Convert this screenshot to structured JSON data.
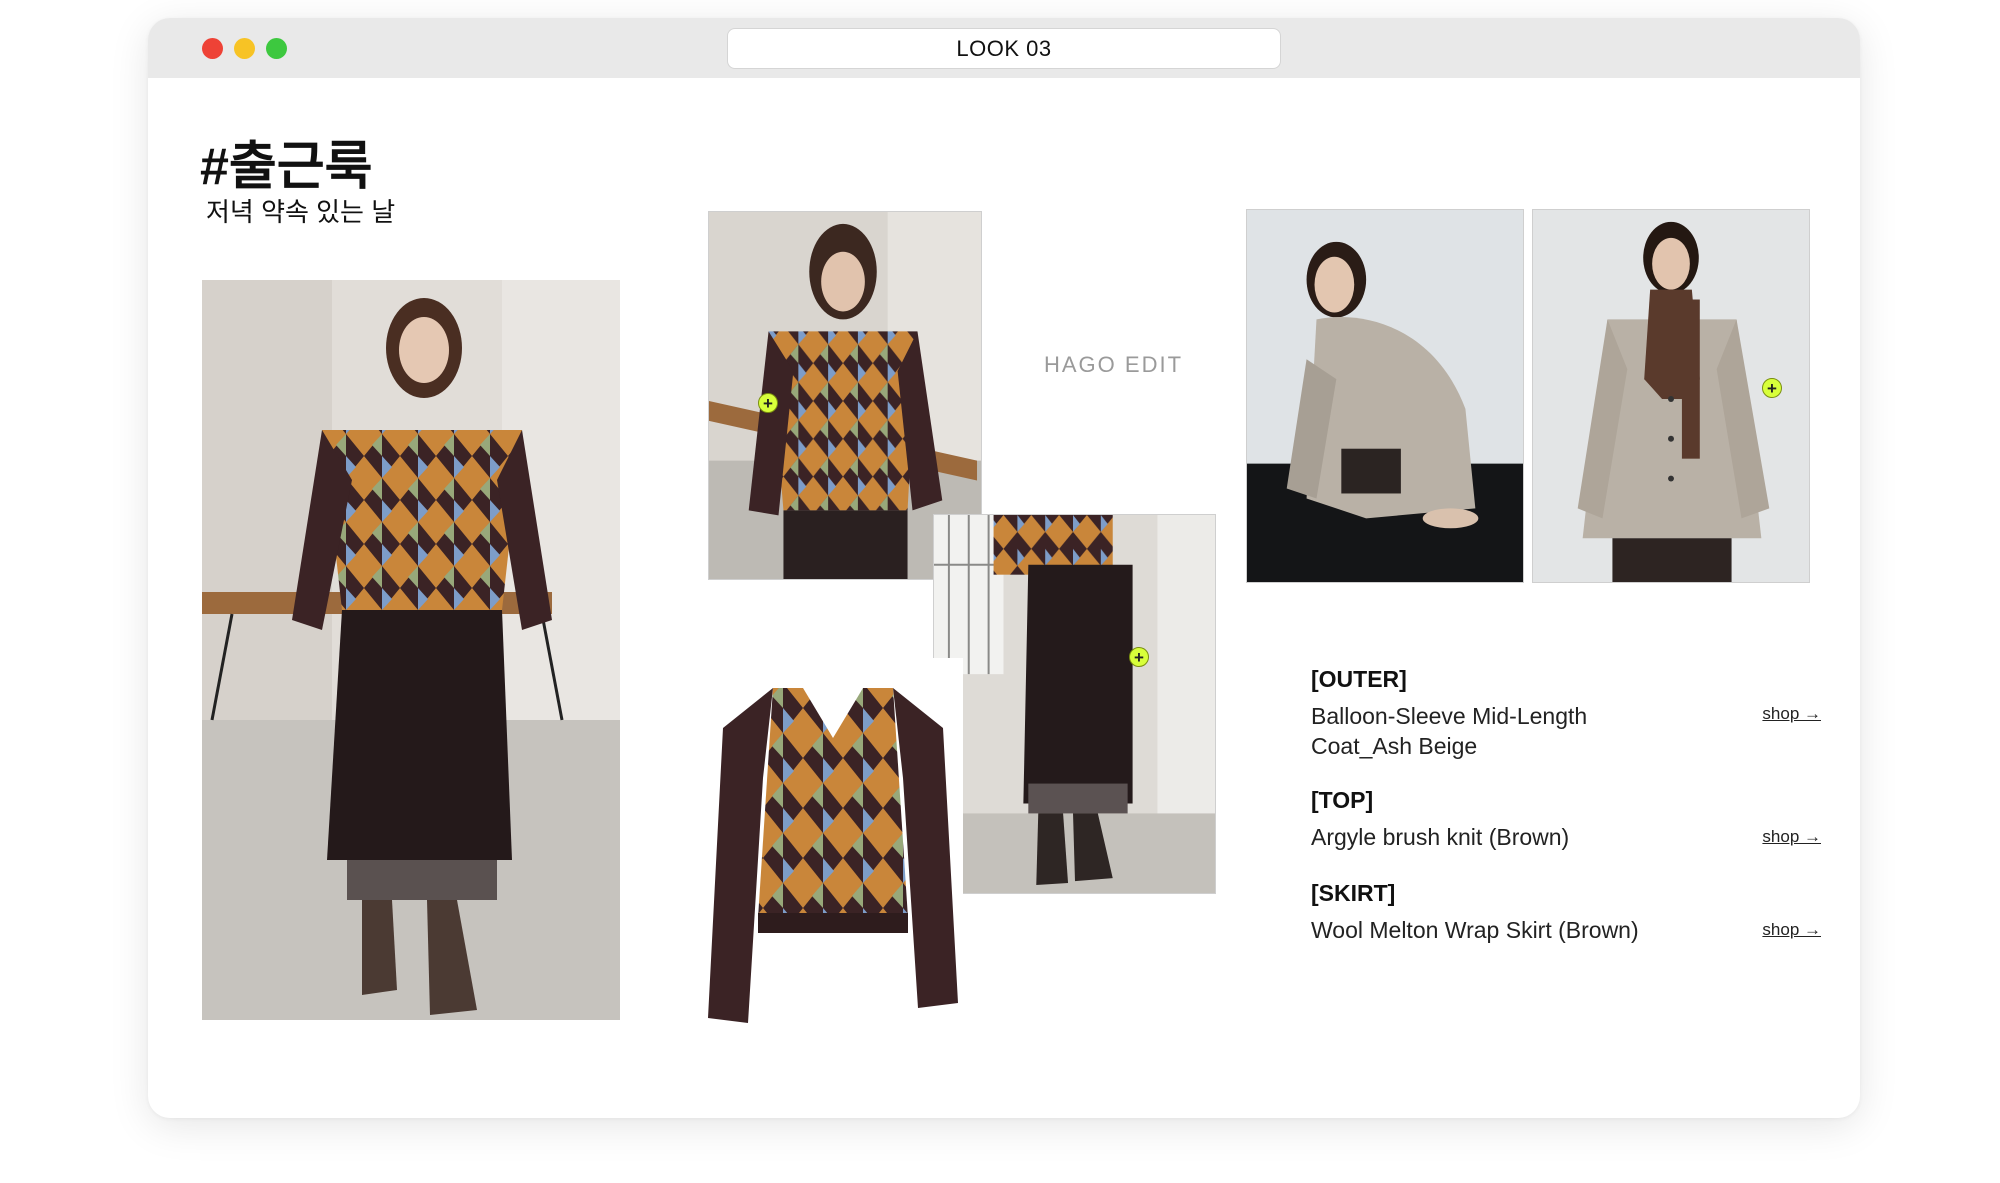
{
  "window": {
    "title": "LOOK 03"
  },
  "look": {
    "hashtag": "#출근룩",
    "subtitle": "저녁 약속 있는 날"
  },
  "brand": "HAGO EDIT",
  "products": [
    {
      "category": "[OUTER]",
      "name": "Balloon-Sleeve Mid-Length Coat_Ash Beige",
      "shop_label": "shop →"
    },
    {
      "category": "[TOP]",
      "name": "Argyle brush knit (Brown)",
      "shop_label": "shop →"
    },
    {
      "category": "[SKIRT]",
      "name": "Wool Melton Wrap Skirt (Brown)",
      "shop_label": "shop →"
    }
  ],
  "hotspot_glyph": "+",
  "colors": {
    "hotspot": "#d8ff3a",
    "knit_brown": "#3b2325",
    "argyle_orange": "#c9863a",
    "argyle_blue": "#7d9dc9",
    "argyle_green": "#98a87a",
    "coat_beige": "#b9b1a6"
  }
}
